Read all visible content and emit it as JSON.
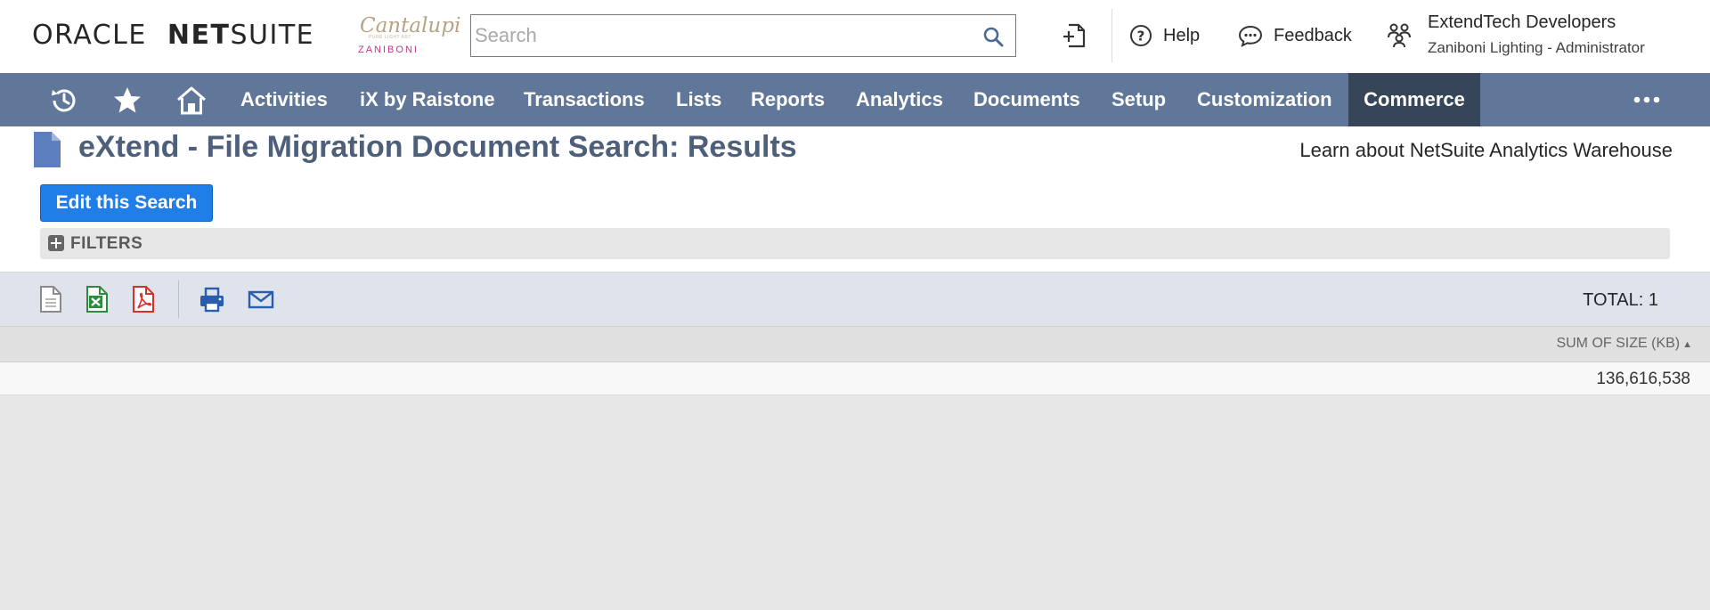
{
  "header": {
    "logo_oracle": "ORACLE",
    "logo_net": "NET",
    "logo_suite": "SUITE",
    "brand": {
      "top": "Cantalupi",
      "tag": "PURE LIGHT ART",
      "bottom": "ZANIBONI"
    },
    "search_placeholder": "Search",
    "help_label": "Help",
    "feedback_label": "Feedback",
    "user_name": "ExtendTech Developers",
    "user_role": "Zaniboni Lighting - Administrator"
  },
  "nav": {
    "items": [
      {
        "label": "Activities"
      },
      {
        "label": "iX by Raistone"
      },
      {
        "label": "Transactions"
      },
      {
        "label": "Lists"
      },
      {
        "label": "Reports"
      },
      {
        "label": "Analytics"
      },
      {
        "label": "Documents"
      },
      {
        "label": "Setup"
      },
      {
        "label": "Customization"
      },
      {
        "label": "Commerce"
      }
    ],
    "active_item": "Commerce",
    "icons": [
      "recent-history-icon",
      "star-icon",
      "home-icon",
      "more-icon"
    ]
  },
  "page": {
    "title": "eXtend - File Migration Document Search: Results",
    "learn_link": "Learn about NetSuite Analytics Warehouse",
    "edit_button": "Edit this Search",
    "filters_label": "FILTERS"
  },
  "results": {
    "total_label": "TOTAL: 1",
    "toolbar_icons": [
      "csv-export-icon",
      "excel-export-icon",
      "pdf-export-icon",
      "print-icon",
      "email-icon"
    ],
    "columns": [
      {
        "label": "SUM OF SIZE (KB)",
        "sort": "ascending"
      }
    ],
    "rows": [
      {
        "size_kb": "136,616,538"
      }
    ]
  },
  "colors": {
    "nav_bg": "#607799",
    "nav_active_bg": "#374559",
    "title": "#4d5f79",
    "primary_button": "#1f7ee8",
    "toolbar_bg": "#dfe4ec"
  }
}
